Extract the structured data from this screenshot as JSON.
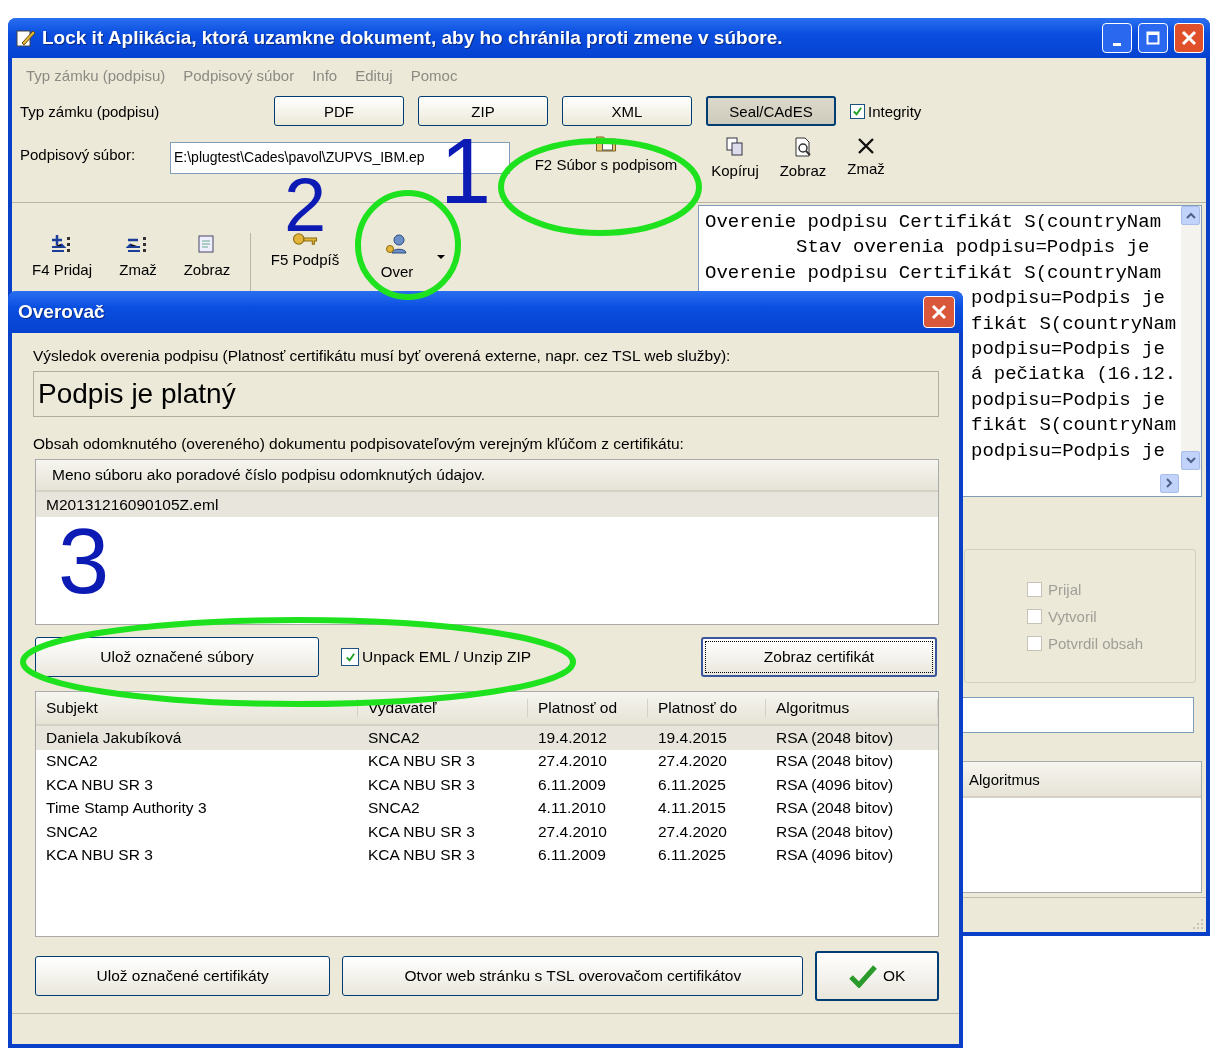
{
  "window": {
    "title": "Lock it Aplikácia, ktorá uzamkne dokument, aby ho chránila proti zmene v súbore."
  },
  "menu": [
    {
      "label": "Typ zámku (podpisu)",
      "disabled": true
    },
    {
      "label": "Podpisový súbor",
      "disabled": true
    },
    {
      "label": "Info",
      "disabled": true
    },
    {
      "label": "Edituj",
      "disabled": true
    },
    {
      "label": "Pomoc",
      "disabled": true
    }
  ],
  "lock_type": {
    "label": "Typ zámku (podpisu)",
    "options": [
      {
        "label": "PDF",
        "selected": false
      },
      {
        "label": "ZIP",
        "selected": false
      },
      {
        "label": "XML",
        "selected": false
      },
      {
        "label": "Seal/CAdES",
        "selected": true
      }
    ],
    "integrity": {
      "label": "Integrity",
      "checked": true
    }
  },
  "signature_file": {
    "label": "Podpisový súbor:",
    "value": "E:\\plugtest\\Cades\\pavol\\ZUPVS_IBM.ep",
    "actions": [
      {
        "label": "F2 Súbor s podpisom"
      },
      {
        "label": "Kopíruj"
      },
      {
        "label": "Zobraz"
      },
      {
        "label": "Zmaž"
      }
    ]
  },
  "toolbar": [
    {
      "label": "F4 Pridaj",
      "dropdown": false
    },
    {
      "label": "Zmaž",
      "dropdown": false
    },
    {
      "label": "Zobraz",
      "dropdown": false
    },
    {
      "label": "F5 Podpíš",
      "dropdown": false
    },
    {
      "label": "Over",
      "dropdown": true
    }
  ],
  "log": {
    "lines": [
      {
        "kind": "line",
        "text": "Overenie podpisu Certifikát S(countryNam"
      },
      {
        "kind": "indented",
        "text": "Stav overenia podpisu=Podpis je"
      },
      {
        "kind": "line",
        "text": "Overenie podpisu Certifikát S(countryNam"
      },
      {
        "kind": "tail",
        "text": "podpisu=Podpis je"
      },
      {
        "kind": "tail",
        "text": "fikát S(countryNam"
      },
      {
        "kind": "tail",
        "text": "podpisu=Podpis je"
      },
      {
        "kind": "tail",
        "text": "á pečiatka (16.12."
      },
      {
        "kind": "tail",
        "text": "podpisu=Podpis je"
      },
      {
        "kind": "tail",
        "text": "fikát S(countryNam"
      },
      {
        "kind": "tail",
        "text": "podpisu=Podpis je"
      }
    ]
  },
  "side_panel": {
    "checkboxes": [
      {
        "label": "Prijal",
        "checked": false,
        "disabled": true
      },
      {
        "label": "Vytvoril",
        "checked": false,
        "disabled": true
      },
      {
        "label": "Potvrdil obsah",
        "checked": false,
        "disabled": true
      }
    ],
    "table": {
      "columns": [
        "Algoritmus"
      ]
    }
  },
  "dialog": {
    "title": "Overovač",
    "result_label": "Výsledok overenia podpisu (Platnosť certifikátu musí byť overená externe, napr. cez TSL web služby):",
    "result": "Podpis je platný",
    "content_label": "Obsah odomknutého (overeného) dokumentu podpisovateľovým verejným kľúčom z certifikátu:",
    "files": {
      "columns": [
        "Meno súboru ako poradové číslo podpisu odomknutých údajov."
      ],
      "rows": [
        {
          "name": "M20131216090105Z.eml",
          "selected": true
        }
      ]
    },
    "save_files_button": "Ulož označené súbory",
    "unpack": {
      "label": "Unpack EML / Unzip ZIP",
      "checked": true
    },
    "show_certificate_button": {
      "label": "Zobraz certifikát",
      "focused": true
    },
    "certificates": {
      "columns": [
        "Subjekt",
        "Vydavateľ",
        "Platnosť od",
        "Platnosť do",
        "Algoritmus"
      ],
      "rows": [
        {
          "cells": [
            "Daniela Jakubíková",
            "SNCA2",
            "19.4.2012",
            "19.4.2015",
            "RSA (2048 bitov)"
          ],
          "selected": true
        },
        {
          "cells": [
            "SNCA2",
            "KCA NBU SR 3",
            "27.4.2010",
            "27.4.2020",
            "RSA (2048 bitov)"
          ],
          "selected": false
        },
        {
          "cells": [
            "KCA NBU SR 3",
            "KCA NBU SR 3",
            "6.11.2009",
            "6.11.2025",
            "RSA (4096 bitov)"
          ],
          "selected": false
        },
        {
          "cells": [
            "Time Stamp Authority 3",
            "SNCA2",
            "4.11.2010",
            "4.11.2015",
            "RSA (2048 bitov)"
          ],
          "selected": false
        },
        {
          "cells": [
            "SNCA2",
            "KCA NBU SR 3",
            "27.4.2010",
            "27.4.2020",
            "RSA (2048 bitov)"
          ],
          "selected": false
        },
        {
          "cells": [
            "KCA NBU SR 3",
            "KCA NBU SR 3",
            "6.11.2009",
            "6.11.2025",
            "RSA (4096 bitov)"
          ],
          "selected": false
        }
      ]
    },
    "bottom_buttons": [
      "Ulož označené certifikáty",
      "Otvor web stránku s TSL overovačom certifikátov",
      "OK"
    ]
  },
  "annotations": [
    "1",
    "2",
    "3"
  ]
}
